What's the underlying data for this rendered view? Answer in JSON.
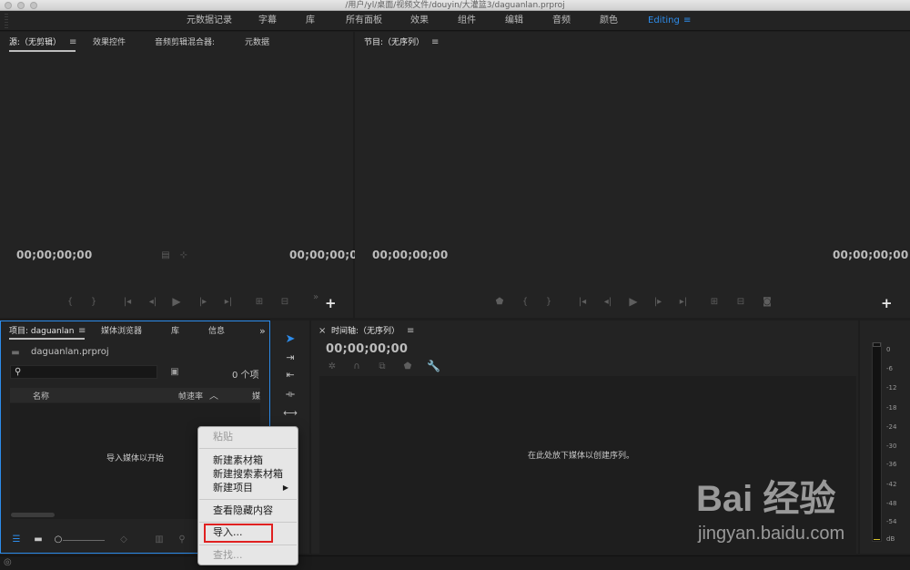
{
  "window": {
    "title": "/用户/yl/桌面/视频文件/douyin/大灌篮3/daguanlan.prproj"
  },
  "workspaces": {
    "items": [
      "元数据记录",
      "字幕",
      "库",
      "所有面板",
      "效果",
      "组件",
      "编辑",
      "音频",
      "颜色",
      "Editing"
    ],
    "active": "Editing",
    "menu_icon": "hamburger-icon"
  },
  "source_panel": {
    "tabs": [
      "源:（无剪辑）",
      "效果控件",
      "音频剪辑混合器:",
      "元数据"
    ],
    "timecode_left": "00;00;00;00",
    "timecode_right": "00;00;00;0"
  },
  "program_panel": {
    "tab": "节目:（无序列）",
    "timecode_left": "00;00;00;00",
    "timecode_right": "00;00;00;00"
  },
  "project_panel": {
    "tabs": [
      "项目: daguanlan",
      "媒体浏览器",
      "库",
      "信息"
    ],
    "overflow": "»",
    "filename": "daguanlan.prproj",
    "item_count": "0 个项",
    "columns": [
      "名称",
      "帧速率",
      "媒"
    ],
    "empty_hint": "导入媒体以开始"
  },
  "timeline_panel": {
    "close": "×",
    "tab": "时间轴:（无序列）",
    "timecode": "00;00;00;00",
    "empty_hint": "在此处放下媒体以创建序列。"
  },
  "audio_meter": {
    "scale": [
      "0",
      "-6",
      "-12",
      "-18",
      "-24",
      "-30",
      "-36",
      "-42",
      "-48",
      "-54",
      "dB"
    ]
  },
  "context_menu": {
    "items": [
      {
        "label": "粘贴",
        "enabled": false
      },
      {
        "label": "新建素材箱",
        "enabled": true
      },
      {
        "label": "新建搜索素材箱",
        "enabled": true
      },
      {
        "label": "新建项目",
        "enabled": true,
        "submenu": "▶"
      },
      {
        "label": "查看隐藏内容",
        "enabled": true
      },
      {
        "label": "导入...",
        "enabled": true,
        "highlighted": true
      },
      {
        "label": "查找...",
        "enabled": false
      }
    ]
  },
  "watermark": {
    "brand": "Bai 经验",
    "url": "jingyan.baidu.com"
  },
  "colors": {
    "accent": "#2d8ceb",
    "highlight": "#e02020",
    "panel": "#232323"
  }
}
